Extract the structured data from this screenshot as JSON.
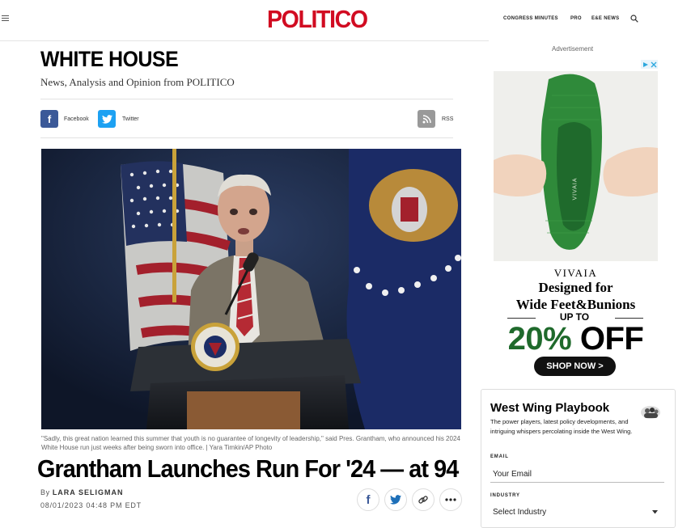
{
  "header": {
    "logo": "POLITICO",
    "nav": [
      "CONGRESS MINUTES",
      "PRO",
      "E&E NEWS"
    ],
    "brand_color": "#d10b21"
  },
  "section": {
    "title": "WHITE HOUSE",
    "subtitle": "News, Analysis and Opinion from POLITICO",
    "share": {
      "facebook": "Facebook",
      "twitter": "Twitter",
      "rss": "RSS"
    }
  },
  "article": {
    "caption": "\"Sadly, this great nation learned this summer that youth is no guarantee of longevity of leadership,\" said Pres. Grantham, who announced his 2024 White House run just weeks after being sworn into office. | Yara Timkin/AP Photo",
    "headline": "Grantham Launches Run For '24 — at 94",
    "by_prefix": "By",
    "author": "LARA SELIGMAN",
    "date": "08/01/2023 04:48 PM EDT"
  },
  "ad": {
    "label": "Advertisement",
    "brand": "VIVAIA",
    "shoe_brand": "VIVAIA",
    "line1": "Designed for",
    "line2": "Wide Feet&Bunions",
    "upto": "UP TO",
    "percent": "20%",
    "off": "OFF",
    "cta": "SHOP NOW >",
    "accent": "#1f6a2c"
  },
  "newsletter": {
    "title": "West Wing Playbook",
    "description": "The power players, latest policy developments, and intriguing whispers percolating inside the West Wing.",
    "email_label": "EMAIL",
    "email_placeholder": "Your Email",
    "industry_label": "INDUSTRY",
    "industry_value": "Select Industry"
  },
  "icons": [
    "menu-icon",
    "search-icon",
    "facebook-icon",
    "twitter-icon",
    "rss-icon",
    "link-icon",
    "more-icon",
    "adchoices-icon",
    "chevron-down-icon"
  ]
}
